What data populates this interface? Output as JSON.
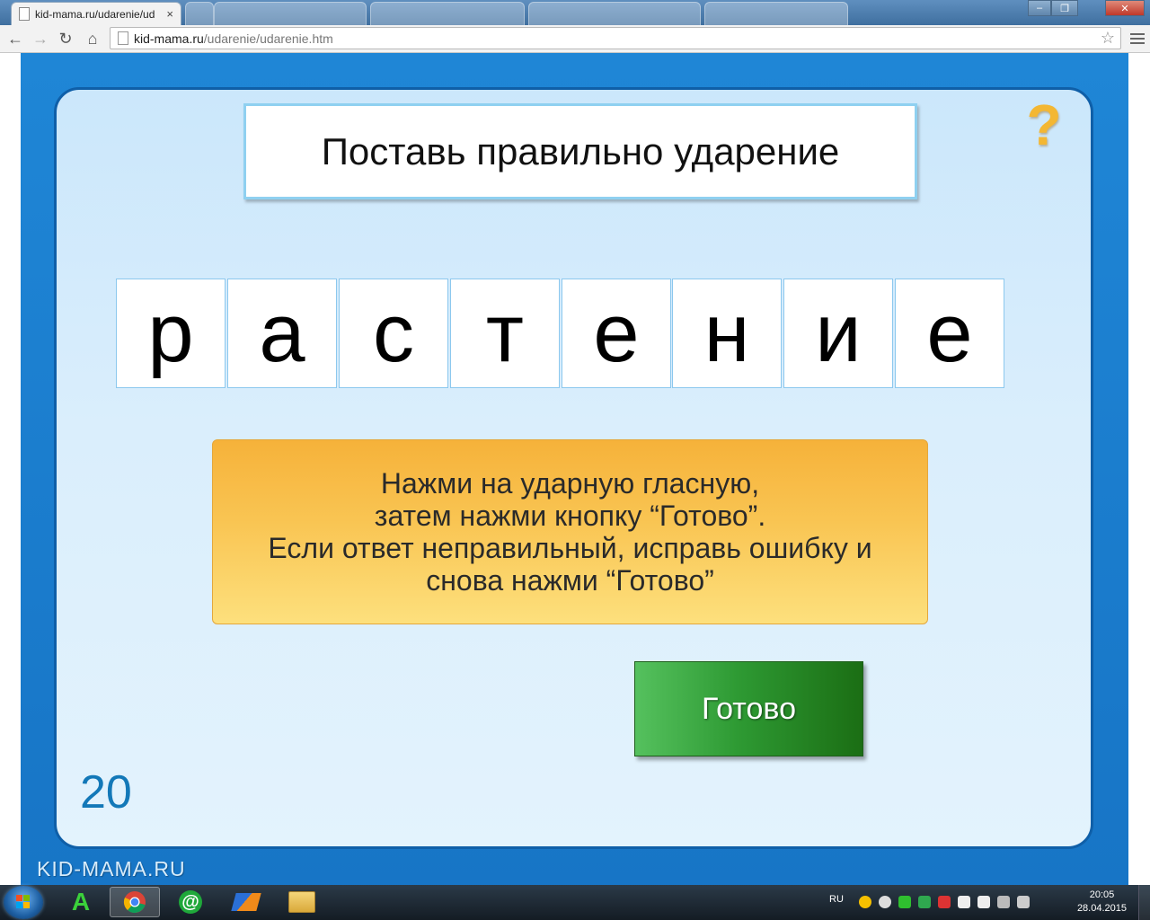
{
  "browser": {
    "active_tab_title": "kid-mama.ru/udarenie/ud",
    "tab_close": "×",
    "url_domain": "kid-mama.ru",
    "url_path": "/udarenie/udarenie.htm",
    "window_min": "–",
    "window_max": "❐",
    "window_close": "✕"
  },
  "game": {
    "title": "Поставь правильно ударение",
    "help_symbol": "?",
    "letters": [
      "р",
      "а",
      "с",
      "т",
      "е",
      "н",
      "и",
      "е"
    ],
    "instruction": [
      "Нажми на ударную гласную,",
      "затем нажми кнопку “Готово”.",
      "Если ответ неправильный, исправь ошибку и",
      "снова нажми “Готово”"
    ],
    "done_label": "Готово",
    "counter": "20",
    "brand": "KID-MAMA.RU"
  },
  "taskbar": {
    "lang": "RU",
    "time": "20:05",
    "date": "28.04.2015"
  },
  "colors": {
    "stage_blue": "#1f86d6",
    "panel_border": "#0f5fa8",
    "instruction_orange": "#f9c553",
    "done_green": "#2e9a33",
    "counter_blue": "#1378b8"
  }
}
